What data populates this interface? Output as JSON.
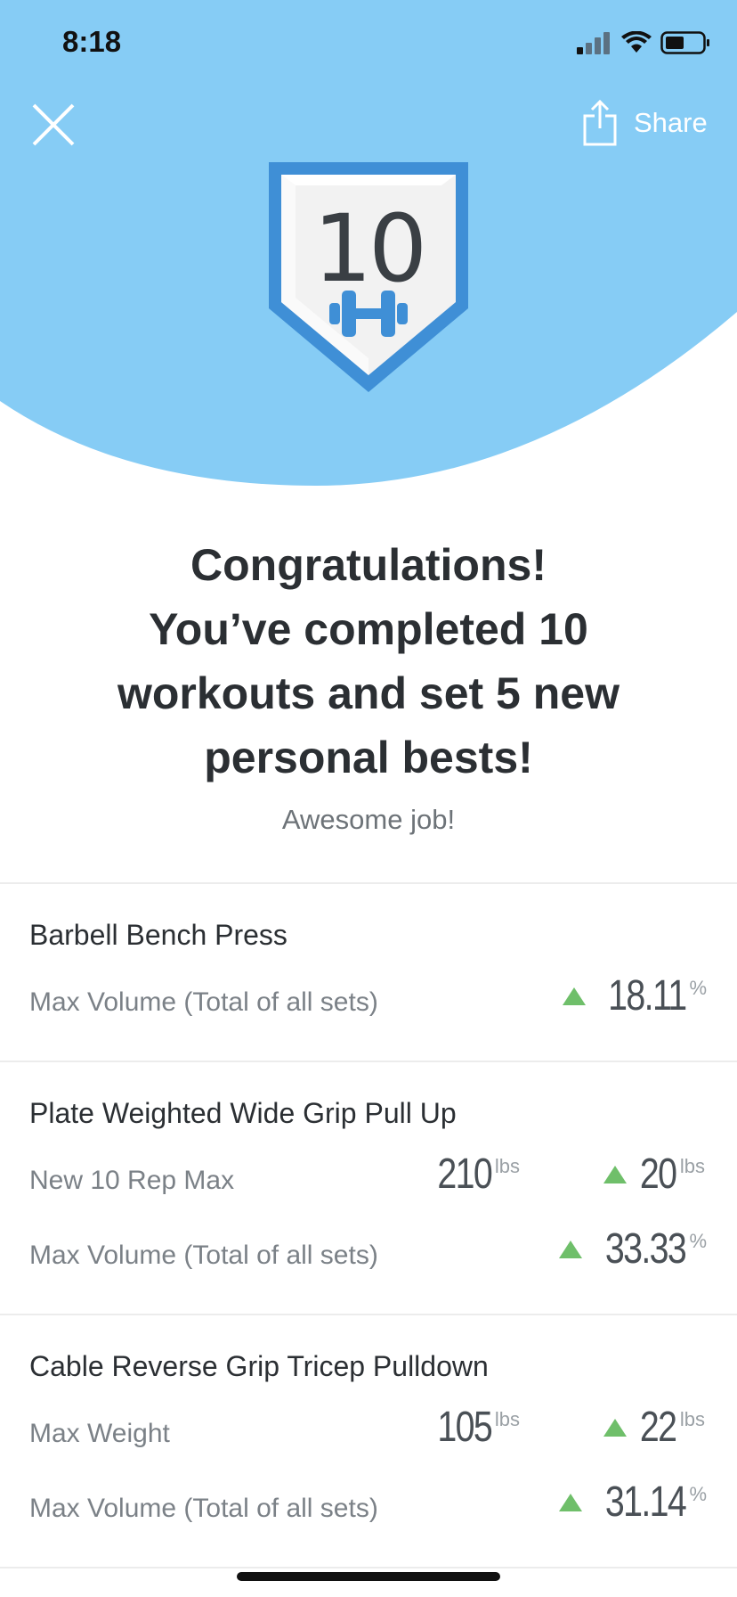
{
  "status_bar": {
    "time": "8:18"
  },
  "header": {
    "share_label": "Share",
    "badge_number": "10"
  },
  "colors": {
    "hero_bg": "#86ccf5",
    "badge_blue": "#3f8fd6",
    "up_green": "#6fbf6a"
  },
  "message": {
    "line1": "Congratulations!",
    "line2": "You’ve completed 10",
    "line3": "workouts and set 5 new",
    "line4": "personal bests!",
    "subtext": "Awesome job!"
  },
  "exercises": [
    {
      "name": "Barbell Bench Press",
      "metrics": [
        {
          "label": "Max Volume (Total of all sets)",
          "change": "18.11",
          "change_unit": "%"
        }
      ]
    },
    {
      "name": "Plate Weighted Wide Grip Pull Up",
      "metrics": [
        {
          "label": "New 10 Rep Max",
          "value": "210",
          "value_unit": "lbs",
          "change": "20",
          "change_unit": "lbs"
        },
        {
          "label": "Max Volume (Total of all sets)",
          "change": "33.33",
          "change_unit": "%"
        }
      ]
    },
    {
      "name": "Cable Reverse Grip Tricep Pulldown",
      "metrics": [
        {
          "label": "Max Weight",
          "value": "105",
          "value_unit": "lbs",
          "change": "22",
          "change_unit": "lbs"
        },
        {
          "label": "Max Volume (Total of all sets)",
          "change": "31.14",
          "change_unit": "%"
        }
      ]
    }
  ]
}
